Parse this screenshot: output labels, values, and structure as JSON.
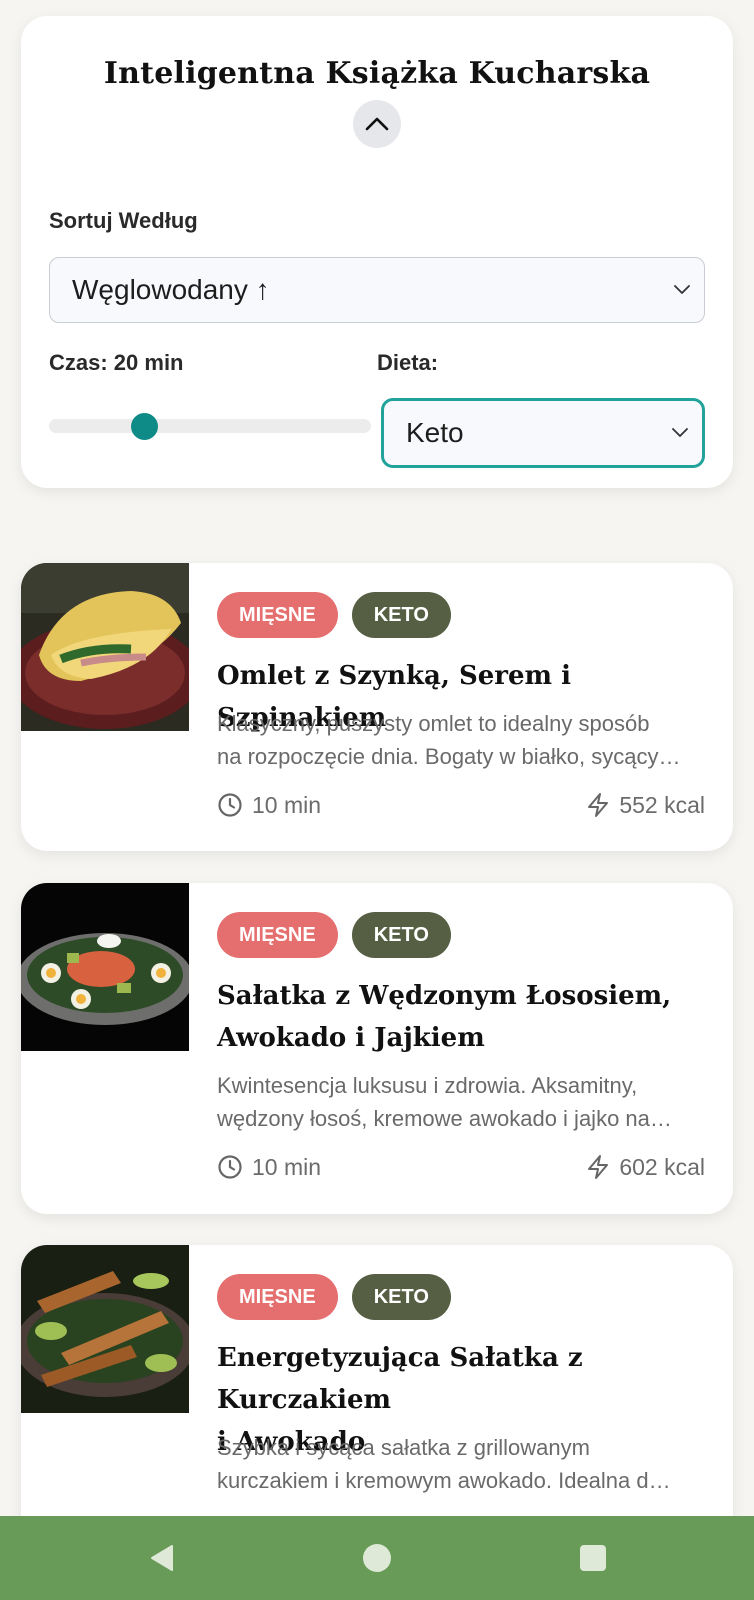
{
  "header": {
    "title": "Inteligentna Książka Kucharska"
  },
  "filters": {
    "sort_label": "Sortuj Według",
    "sort_value": "Węglowodany ↑",
    "time_label": "Czas: 20 min",
    "time_value_min": 20,
    "diet_label": "Dieta:",
    "diet_value": "Keto"
  },
  "recipes": [
    {
      "tags": [
        "MIĘSNE",
        "KETO"
      ],
      "title_lines": [
        "Omlet z Szynką, Serem i Szpinakiem"
      ],
      "desc_lines": [
        "Klasyczny, puszysty omlet to idealny sposób",
        "na rozpoczęcie dnia. Bogaty w białko, sycący…"
      ],
      "time": "10 min",
      "kcal": "552 kcal"
    },
    {
      "tags": [
        "MIĘSNE",
        "KETO"
      ],
      "title_lines": [
        "Sałatka z Wędzonym Łososiem,",
        "Awokado i Jajkiem"
      ],
      "desc_lines": [
        "Kwintesencja luksusu i zdrowia. Aksamitny,",
        "wędzony łosoś, kremowe awokado i jajko na…"
      ],
      "time": "10 min",
      "kcal": "602 kcal"
    },
    {
      "tags": [
        "MIĘSNE",
        "KETO"
      ],
      "title_lines": [
        "Energetyzująca Sałatka z Kurczakiem",
        "i Awokado"
      ],
      "desc_lines": [
        "Szybka i sycąca sałatka z grillowanym",
        "kurczakiem i kremowym awokado. Idealna d…"
      ],
      "time": "",
      "kcal": ""
    }
  ],
  "icons": {
    "collapse": "chevron-up-icon",
    "dropdown": "chevron-down-icon",
    "time": "clock-icon",
    "energy": "lightning-icon",
    "nav_back": "back-triangle-icon",
    "nav_home": "home-circle-icon",
    "nav_recents": "recents-square-icon"
  },
  "colors": {
    "accent": "#0e8b86",
    "meat_tag": "#e56e6e",
    "keto_tag": "#565f44",
    "navbar": "#679b57"
  }
}
